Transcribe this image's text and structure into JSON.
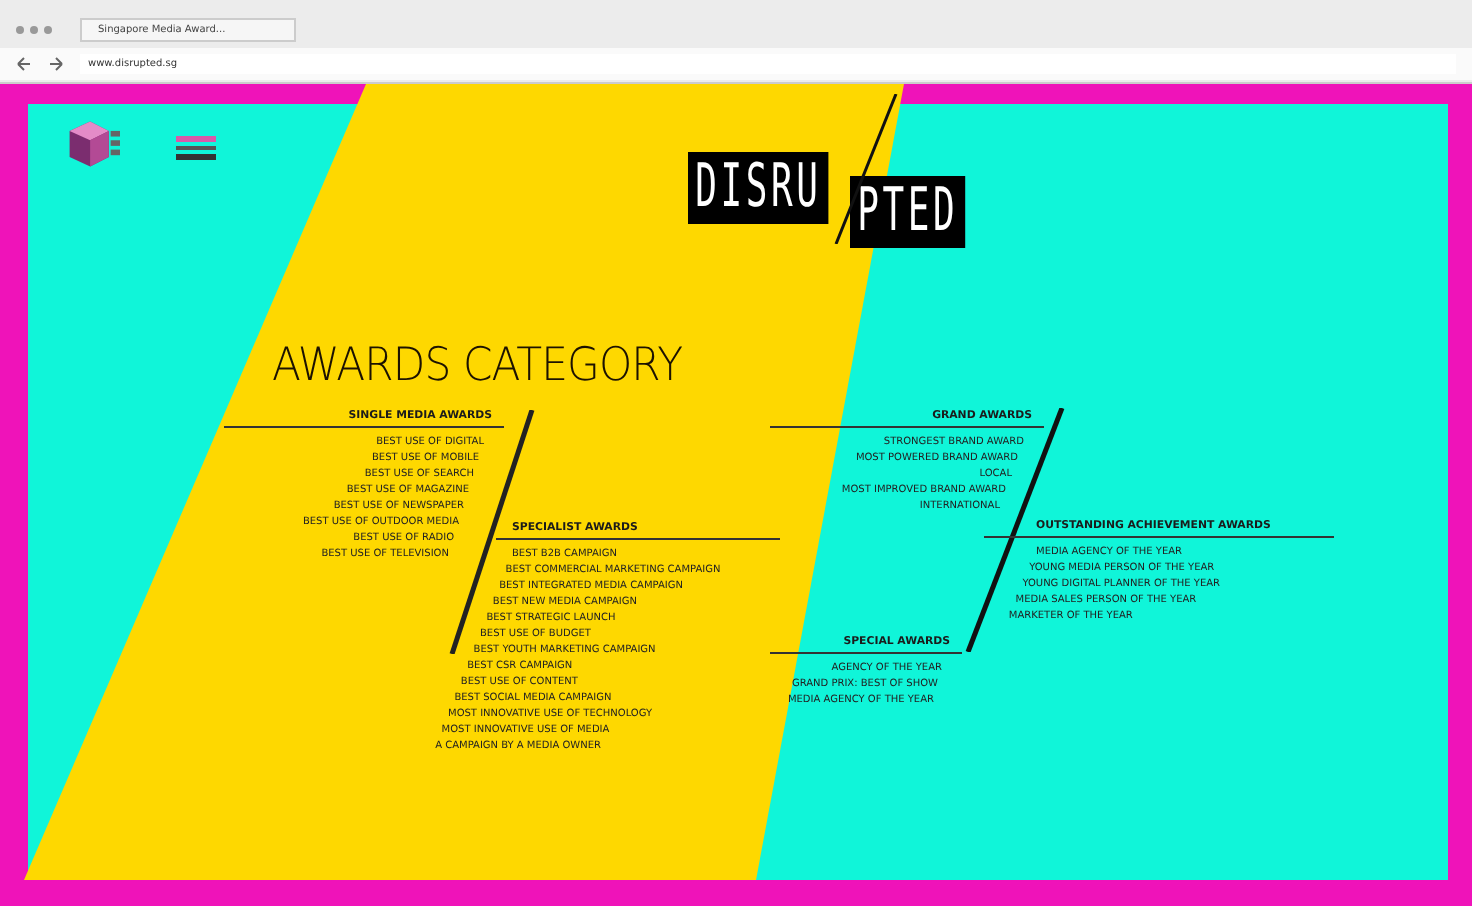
{
  "browser": {
    "tab_title": "Singapore Media Award...",
    "address": "www.disrupted.sg"
  },
  "logo": [
    "DISRU",
    "PTED"
  ],
  "heading": "AWARDS CATEGORY",
  "sections": [
    {
      "title": "SINGLE MEDIA AWARDS",
      "items": [
        "BEST USE OF DIGITAL",
        "BEST USE OF MOBILE",
        "BEST USE OF SEARCH",
        "BEST USE OF MAGAZINE",
        "BEST USE OF NEWSPAPER",
        "BEST USE OF OUTDOOR MEDIA",
        "BEST USE OF RADIO",
        "BEST USE OF TELEVISION"
      ]
    },
    {
      "title": "SPECIALIST AWARDS",
      "items": [
        "BEST B2B CAMPAIGN",
        "BEST COMMERCIAL MARKETING CAMPAIGN",
        "BEST INTEGRATED MEDIA CAMPAIGN",
        "BEST NEW MEDIA CAMPAIGN",
        "BEST STRATEGIC LAUNCH",
        "BEST USE OF BUDGET",
        "BEST YOUTH MARKETING CAMPAIGN",
        "BEST CSR CAMPAIGN",
        "BEST USE OF CONTENT",
        "BEST SOCIAL MEDIA CAMPAIGN",
        "MOST INNOVATIVE USE OF TECHNOLOGY",
        "MOST INNOVATIVE USE OF MEDIA",
        "A CAMPAIGN BY A MEDIA OWNER"
      ]
    },
    {
      "title": "GRAND AWARDS",
      "items": [
        "STRONGEST BRAND AWARD",
        "MOST POWERED BRAND AWARD",
        "LOCAL",
        "MOST IMPROVED BRAND AWARD",
        "INTERNATIONAL"
      ]
    },
    {
      "title": "OUTSTANDING ACHIEVEMENT AWARDS",
      "items": [
        "MEDIA AGENCY OF THE YEAR",
        "YOUNG MEDIA PERSON OF THE YEAR",
        "YOUNG DIGITAL PLANNER OF THE YEAR",
        "MEDIA SALES PERSON OF THE YEAR",
        "MARKETER OF THE YEAR"
      ]
    },
    {
      "title": "SPECIAL AWARDS",
      "items": [
        "AGENCY OF THE YEAR",
        "GRAND PRIX: BEST OF SHOW",
        "MEDIA AGENCY OF THE YEAR"
      ]
    }
  ]
}
